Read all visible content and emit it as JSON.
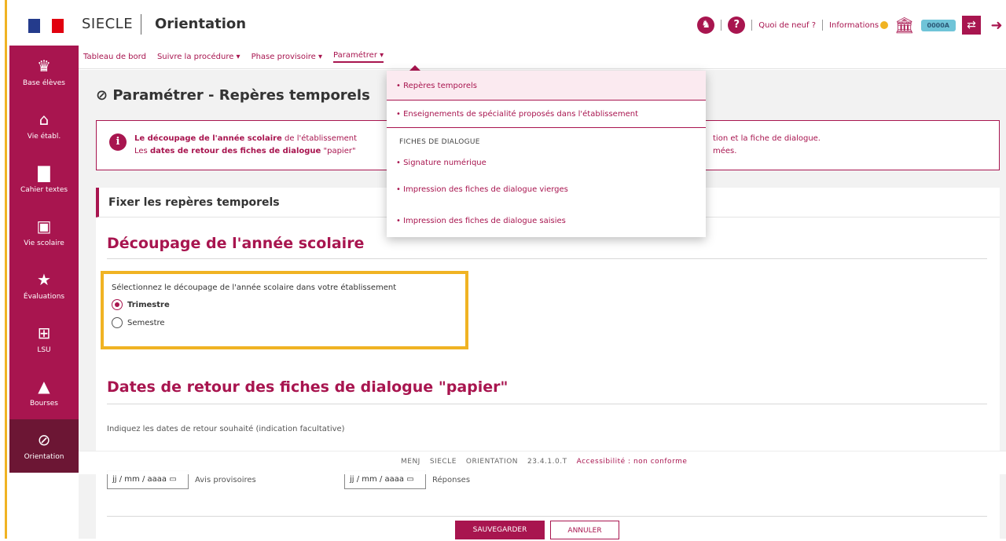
{
  "header": {
    "app_name": "SIECLE",
    "module_name": "Orientation",
    "links": {
      "whats_new": "Quoi de neuf ?",
      "informations": "Informations"
    },
    "user_tag": "0000A",
    "icons": [
      "help-icon",
      "question-icon",
      "bank-icon",
      "switch-icon",
      "logout-icon"
    ]
  },
  "sidebar": {
    "items": [
      {
        "label": "Base élèves",
        "icon": "users-icon",
        "glyph": "♛"
      },
      {
        "label": "Vie établ.",
        "icon": "bank-icon",
        "glyph": "⌂"
      },
      {
        "label": "Cahier textes",
        "icon": "book-icon",
        "glyph": "▇"
      },
      {
        "label": "Vie scolaire",
        "icon": "calendar-icon",
        "glyph": "▣"
      },
      {
        "label": "Évaluations",
        "icon": "star-icon",
        "glyph": "★"
      },
      {
        "label": "LSU",
        "icon": "open-book-icon",
        "glyph": "⊞"
      },
      {
        "label": "Bourses",
        "icon": "bag-icon",
        "glyph": "▲"
      },
      {
        "label": "Orientation",
        "icon": "compass-icon",
        "glyph": "⊘"
      }
    ]
  },
  "nav": {
    "items": [
      "Tableau de bord",
      "Suivre la procédure ▾",
      "Phase provisoire ▾",
      "Paramétrer ▾"
    ]
  },
  "page": {
    "title": "⊘ Paramétrer - Repères temporels",
    "info": {
      "line1_bold": "Le découpage de l'année scolaire",
      "line1_rest": " de l'établissement",
      "line1_end": "tion et la fiche de dialogue.",
      "line2_pre": "Les ",
      "line2_bold": "dates de retour des fiches de dialogue",
      "line2_rest": " \"papier\"",
      "line2_end": "mées."
    },
    "card_title": "Fixer les repères temporels",
    "section1": "Découpage de l'année scolaire",
    "choice_label": "Sélectionnez le découpage de l'année scolaire dans votre établissement",
    "options": [
      "Trimestre",
      "Semestre"
    ],
    "selected": "Trimestre",
    "section2": "Dates de retour des fiches de dialogue \"papier\"",
    "dates_hint": "Indiquez les dates de retour souhaité (indication facultative)",
    "date_placeholder": "jj / mm / aaaa",
    "date_label1": "Avis provisoires",
    "date_label2": "Réponses",
    "save": "SAUVEGARDER",
    "cancel": "ANNULER"
  },
  "footer": {
    "parts": [
      "MENJ",
      "SIECLE",
      "ORIENTATION",
      "23.4.1.0.T"
    ],
    "link": "Accessibilité : non conforme"
  },
  "dropdown": {
    "items": [
      "• Repères temporels",
      "• Enseignements de spécialité proposés dans l'établissement"
    ],
    "header": "FICHES DE DIALOGUE",
    "sub_items": [
      "• Signature numérique",
      "• Impression des fiches de dialogue vierges",
      "• Impression des fiches de dialogue saisies"
    ]
  },
  "colors": {
    "accent": "#a8154f",
    "highlight": "#f0b323",
    "sidebar_active": "#6c1634"
  }
}
